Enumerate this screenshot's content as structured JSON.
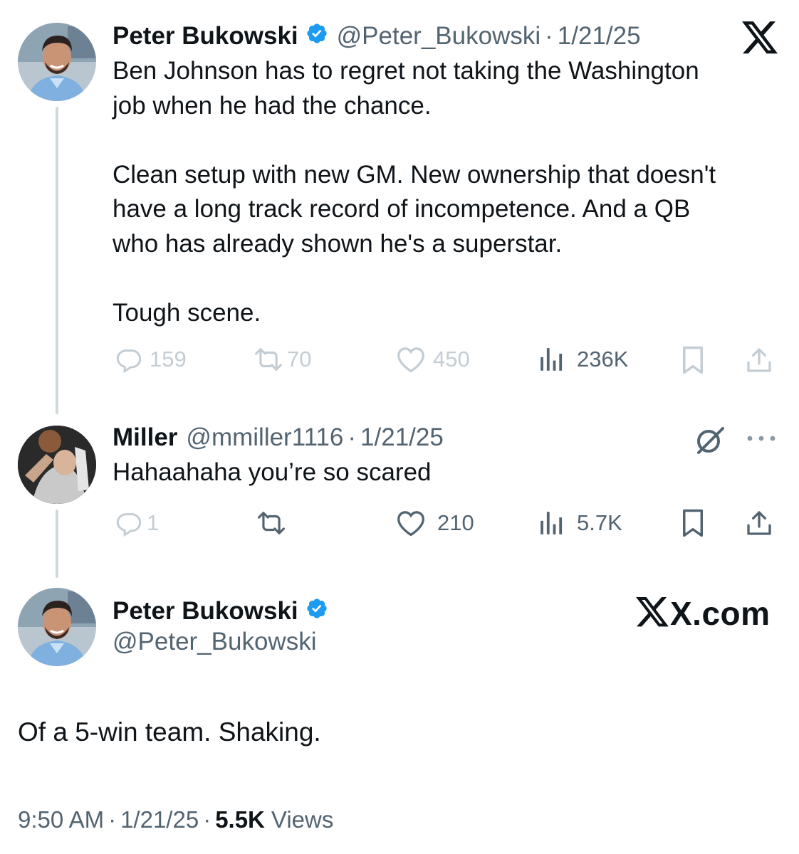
{
  "tweets": [
    {
      "author_name": "Peter Bukowski",
      "handle": "@Peter_Bukowski",
      "separator": "·",
      "date": "1/21/25",
      "text": "Ben Johnson has to regret not taking the Washington\njob when he had the chance.\n\nClean setup with new GM. New ownership that doesn't\nhave a long track record of incompetence. And a QB\nwho has already shown he's a superstar.\n\nTough scene.",
      "replies": "159",
      "reposts": "70",
      "likes": "450",
      "views": "236K"
    },
    {
      "author_name": "Miller",
      "handle": "@mmiller1116",
      "separator": "·",
      "date": "1/21/25",
      "text": "Hahaahaha you’re so scared",
      "replies": "1",
      "likes": "210",
      "views": "5.7K"
    }
  ],
  "main_tweet": {
    "author_name": "Peter Bukowski",
    "handle": "@Peter_Bukowski",
    "text": "Of a 5-win team. Shaking.",
    "time": "9:50 AM",
    "separator": "·",
    "date": "1/21/25",
    "views_count": "5.5K",
    "views_label": "Views"
  },
  "watermark": {
    "label": "X.com"
  },
  "colors": {
    "verified": "#1d9bf0",
    "text": "#0f1419",
    "muted": "#536471",
    "faded": "#c4cdd3",
    "thread_line": "#cfd9de"
  },
  "icons": [
    "x-logo-icon",
    "verified-badge-icon",
    "reply-icon",
    "repost-icon",
    "like-icon",
    "views-icon",
    "bookmark-icon",
    "share-icon",
    "grok-icon",
    "more-icon"
  ]
}
